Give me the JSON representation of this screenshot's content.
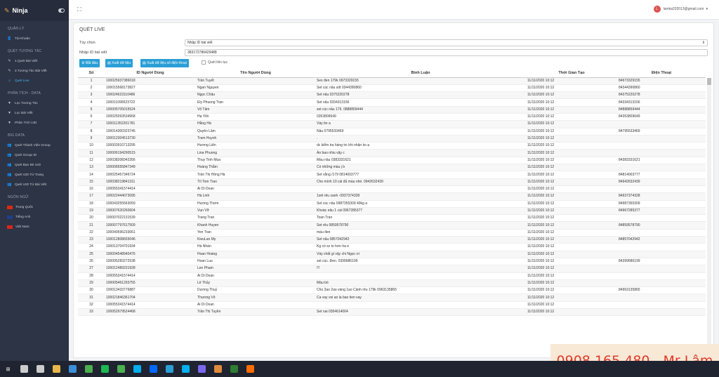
{
  "app": {
    "name": "Ninja"
  },
  "sidebar": {
    "sections": [
      {
        "title": "QUẢN LÝ",
        "items": [
          {
            "label": "Tài Khoản",
            "icon": "user-icon"
          }
        ]
      },
      {
        "title": "QUÉT TƯƠNG TÁC",
        "items": [
          {
            "label": "1.Quét Bài Viết",
            "icon": "edit-icon"
          },
          {
            "label": "2.Tương Tác Bài Viết",
            "icon": "edit-icon"
          },
          {
            "label": "Quét Live",
            "icon": "search-icon",
            "active": true
          }
        ]
      },
      {
        "title": "PHÂN TÍCH - DATA",
        "items": [
          {
            "label": "Lọc Tương Tác",
            "icon": "filter-icon"
          },
          {
            "label": "Lọc Bài Viết",
            "icon": "filter-icon"
          },
          {
            "label": "Phân Tích UID",
            "icon": "filter-icon"
          }
        ]
      },
      {
        "title": "BIG DATA",
        "items": [
          {
            "label": "Quét Thành Viên Group",
            "icon": "users-icon"
          },
          {
            "label": "Quét Group ID",
            "icon": "users-icon"
          },
          {
            "label": "Quét Bạn Bè UID",
            "icon": "users-icon"
          },
          {
            "label": "Quét UID Từ Trang",
            "icon": "users-icon"
          },
          {
            "label": "Quét UID Từ Bài Viết",
            "icon": "users-icon"
          }
        ]
      },
      {
        "title": "NGÔN NGỮ",
        "items": [
          {
            "label": "Trung Quốc",
            "icon": "flag-cn-icon"
          },
          {
            "label": "Tiếng Anh",
            "icon": "flag-uk-icon"
          },
          {
            "label": "Việt Nam",
            "icon": "flag-vn-icon"
          }
        ]
      }
    ]
  },
  "topbar": {
    "user_email": "lamka202013@gmail.com",
    "user_initial": "L"
  },
  "panel": {
    "title": "QUÉT LIVE",
    "option_label": "Tùy chọn",
    "option_value": "Nhập ID bài viết",
    "post_id_label": "Nhập ID bài viết",
    "post_id_value": "383172786429488",
    "buttons": {
      "start": "Bắt đầu",
      "export": "Xuất dữ liệu",
      "export_phone": "Xuất dữ liệu số điện thoại"
    },
    "continuous_label": "Quét liên tục"
  },
  "table": {
    "headers": [
      "Số",
      "ID Người Dùng",
      "Tên Người Dùng",
      "Bình Luận",
      "Thời Gian Tạo",
      "Điện Thoại"
    ],
    "rows": [
      [
        "1",
        "100025937386018",
        "Trần Tuyết",
        "Sex đen 179k 0973329155",
        "11/11/2020 10:12",
        "84973329155"
      ],
      [
        "2",
        "100015568173827",
        "Ngan Nguyen",
        "Set cúc nâu sdt 0344390860",
        "11/11/2020 10:12",
        "84344390860"
      ],
      [
        "3",
        "100024623110486",
        "Ngọc Châu",
        "Set nâu 0375220278",
        "11/11/2020 10:12",
        "84375220278"
      ],
      [
        "4",
        "100011096523722",
        "Ely Phuong Tran",
        "Set nâu 0334313156",
        "11/11/2020 10:12",
        "84334313156"
      ],
      [
        "5",
        "100005705015524",
        "Võ Tâm",
        "set cúc nâu 179. 0888859444",
        "11/11/2020 10:12",
        "84888859444"
      ],
      [
        "6",
        "100025093534958",
        "Hạ Yến",
        "0353809649",
        "11/11/2020 10:12",
        "84353809649"
      ],
      [
        "7",
        "100011352201781",
        "Hằng Hà",
        "Váy bn a",
        "11/11/2020 10:12",
        ""
      ],
      [
        "8",
        "100014300323745",
        "Quyên Lâm",
        "Nâu 0795533469",
        "11/11/2020 10:12",
        "84795533469"
      ],
      [
        "9",
        "100012304513730",
        "Tram Huynh",
        ".",
        "11/11/2020 10:12",
        ""
      ],
      [
        "10",
        "100003910713295",
        "Hương Liên",
        "dc kiểm tra hàng trc khi nhận ko ạ",
        "11/11/2020 10:12",
        ""
      ],
      [
        "11",
        "100006194290515",
        "Lina Phuong",
        "Áo bao nhiu vậy c",
        "11/11/2020 10:12",
        ""
      ],
      [
        "12",
        "100038208342356",
        "Thuy Tinh Mua",
        "Màu nâu 0383331621",
        "11/11/2020 10:12",
        "84383331621"
      ],
      [
        "13",
        "100006555847349",
        "Hoàng Thắm",
        "Có những màu j b",
        "11/11/2020 10:12",
        ""
      ],
      [
        "14",
        "100025457346724",
        "Trần Thị Hồng Hà",
        "Set vằng /179 0814003777",
        "11/11/2020 10:12",
        "84814003777"
      ],
      [
        "15",
        "100038219841311",
        "Tít Tom Tran",
        "Cho mình 10 cái đủ màu nhé. 0942632439",
        "11/11/2020 10:12",
        "84942632439"
      ],
      [
        "16",
        "100055341574414",
        "Ai Di Doan",
        "",
        "11/11/2020 10:12",
        ""
      ],
      [
        "17",
        "100022444073095",
        "Hà Linh",
        "1sét rêu xanh -0937374328",
        "11/11/2020 10:12",
        "84937374328"
      ],
      [
        "18",
        "100043255563059",
        "Hương Thơm",
        "Set cúc nâu 0987355309 40kg a",
        "11/11/2020 10:12",
        "84987355309"
      ],
      [
        "19",
        "100007620260604",
        "Vụn Vỡ",
        "Khoác nâu 1 cái 0967285377",
        "11/11/2020 10:12",
        "84967285377"
      ],
      [
        "20",
        "100007022131539",
        "Trang Tran",
        "Toan Tran",
        "11/11/2020 10:12",
        ""
      ],
      [
        "21",
        "100007797617509",
        "Khanh Huyen",
        "Set rêu 0859578790",
        "11/11/2020 10:12",
        "84859578790"
      ],
      [
        "22",
        "100040596233061",
        "Yen Tran",
        "màu đen",
        "11/11/2020 10:12",
        ""
      ],
      [
        "23",
        "100012808655046",
        "KieuLan My",
        "Set nâu 0857042942",
        "11/11/2020 10:12",
        "84857042942"
      ],
      [
        "24",
        "100013704701934",
        "Hà Nhàn",
        "Kg có sz to hơn ha e",
        "11/11/2020 10:12",
        ""
      ],
      [
        "25",
        "100004548940476",
        "Hoan Hoàng",
        "Váy chất gì vậy chi Ngọc ơi",
        "11/11/2020 10:12",
        ""
      ],
      [
        "26",
        "100005283272538",
        "Hoan Luu",
        "set cúc. Đen. 0399686199",
        "11/11/2020 10:12",
        "84399686199"
      ],
      [
        "27",
        "100012489231928",
        "Len Pham",
        "!!!",
        "11/11/2020 10:12",
        ""
      ],
      [
        "28",
        "100055341574414",
        "Ai Di Doan",
        "",
        "11/11/2020 10:12",
        ""
      ],
      [
        "29",
        "100005461293755",
        "Lê Thủy",
        "Màu bò",
        "11/11/2020 10:12",
        ""
      ],
      [
        "30",
        "100013433776887",
        "Dương Thuỷ",
        "Cho 3ao 2ao vàng 1ao Cánh rêu 179k 0963135865",
        "11/11/2020 10:12",
        "84963135865"
      ],
      [
        "31",
        "100021846361704",
        "Thương Võ",
        "Ca vay voi ao la bao tien vay",
        "11/11/2020 10:12",
        ""
      ],
      [
        "32",
        "100055341574414",
        "Ai Di Doan",
        "",
        "11/11/2020 10:12",
        ""
      ],
      [
        "33",
        "100052979524468",
        "Trần Thị Tuyền",
        "Set nai 0354614064",
        "11/11/2020 10:12",
        ""
      ]
    ]
  },
  "watermark": {
    "text": "0908.165.480 - Mr Lâm"
  },
  "taskbar": {
    "icons": [
      "windows-start-icon",
      "search-icon",
      "task-view-icon",
      "explorer-icon",
      "app-icon",
      "chrome-icon",
      "spotify-icon",
      "chrome-icon",
      "skype-icon",
      "zalo-icon",
      "app-icon",
      "skype-icon",
      "app-icon",
      "app-icon",
      "terminal-icon",
      "app-icon"
    ]
  },
  "colors": {
    "sidebar_bg": "#2d3446",
    "accent": "#2a9fd6",
    "active_item": "#46b6e8",
    "watermark_text": "#e03a2a"
  }
}
